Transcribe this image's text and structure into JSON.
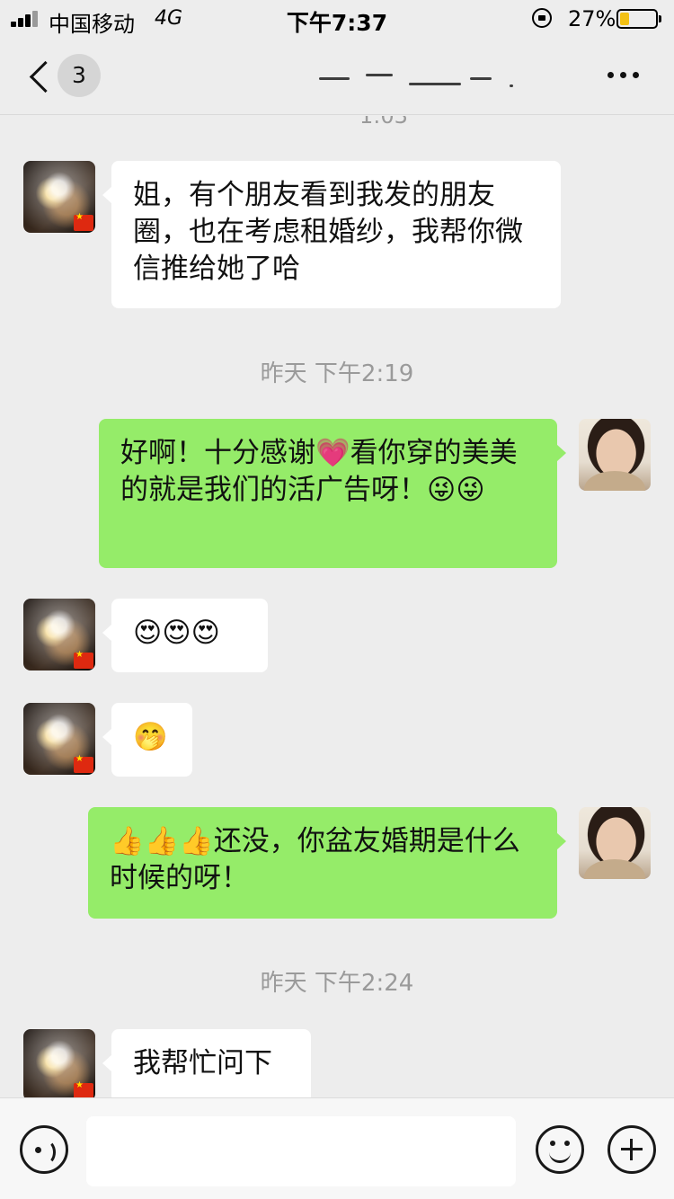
{
  "status_bar": {
    "carrier": "中国移动",
    "network": "4G",
    "time": "下午7:37",
    "battery_percent_label": "27%",
    "battery_level": 0.27
  },
  "nav": {
    "unread_count": "3"
  },
  "chat": {
    "partial_timestamp": "1:03",
    "timestamps": [
      "昨天 下午2:19",
      "昨天 下午2:24"
    ],
    "messages": [
      {
        "from": "friend",
        "text": "姐，有个朋友看到我发的朋友圈，也在考虑租婚纱，我帮你微信推给她了哈"
      },
      {
        "from": "me",
        "text": "好啊！十分感谢💗看你穿的美美的就是我们的活广告呀！😜😜"
      },
      {
        "from": "friend",
        "text": "😍😍😍"
      },
      {
        "from": "friend",
        "text": "🤭"
      },
      {
        "from": "me",
        "text": "👍👍👍还没，你盆友婚期是什么时候的呀！"
      },
      {
        "from": "friend",
        "text": "我帮忙问下"
      }
    ]
  },
  "input_bar": {
    "placeholder": ""
  }
}
